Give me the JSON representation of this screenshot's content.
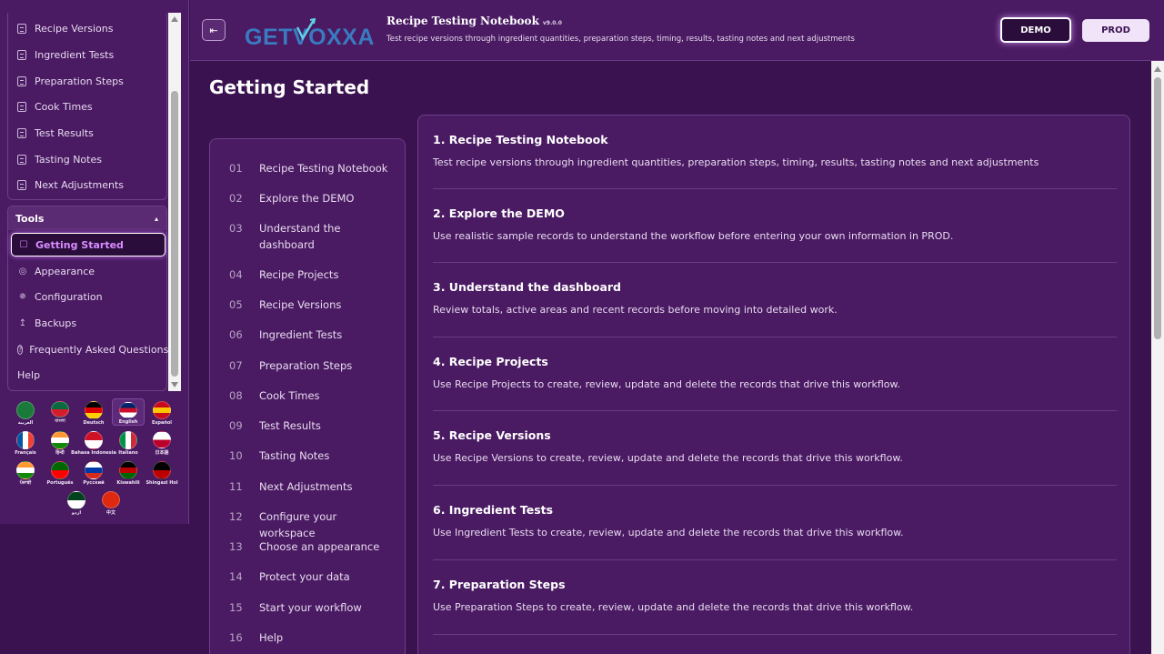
{
  "sidebar": {
    "nav_items": [
      {
        "label": "Recipe Versions"
      },
      {
        "label": "Ingredient Tests"
      },
      {
        "label": "Preparation Steps"
      },
      {
        "label": "Cook Times"
      },
      {
        "label": "Test Results"
      },
      {
        "label": "Tasting Notes"
      },
      {
        "label": "Next Adjustments"
      }
    ],
    "tools": {
      "title": "Tools",
      "collapse_glyph": "▴",
      "items": [
        {
          "label": "Getting Started",
          "icon": "☐",
          "icon_name": "cursor-icon"
        },
        {
          "label": "Appearance",
          "icon": "◎",
          "icon_name": "palette-icon"
        },
        {
          "label": "Configuration",
          "icon": "✵",
          "icon_name": "gear-icon"
        },
        {
          "label": "Backups",
          "icon": "↥",
          "icon_name": "upload-icon"
        },
        {
          "label": "Frequently Asked Questions",
          "icon": "?",
          "icon_name": "question-icon"
        },
        {
          "label": "Help",
          "icon": "",
          "icon_name": ""
        }
      ]
    },
    "languages": [
      {
        "label": "العربية",
        "colors": [
          "#1a7a3a",
          "#1a7a3a"
        ]
      },
      {
        "label": "বাংলা",
        "colors": [
          "#0a6a3e",
          "#d41c2c"
        ]
      },
      {
        "label": "Deutsch",
        "colors": [
          "#000000",
          "#dd0000",
          "#ffce00"
        ]
      },
      {
        "label": "English",
        "colors": [
          "#012169",
          "#c8102e",
          "#ffffff"
        ]
      },
      {
        "label": "Español",
        "colors": [
          "#c60b1e",
          "#ffc400",
          "#c60b1e"
        ]
      },
      {
        "label": "Français",
        "colors": [
          "#0055a4",
          "#ffffff",
          "#ef4135"
        ]
      },
      {
        "label": "हिन्दी",
        "colors": [
          "#ff9933",
          "#ffffff",
          "#138808"
        ]
      },
      {
        "label": "Bahasa Indonesia",
        "colors": [
          "#ce1126",
          "#ffffff"
        ]
      },
      {
        "label": "Italiano",
        "colors": [
          "#009246",
          "#ffffff",
          "#ce2b37"
        ]
      },
      {
        "label": "日本語",
        "colors": [
          "#ffffff",
          "#bc002d"
        ]
      },
      {
        "label": "ਪੰਜਾਬੀ",
        "colors": [
          "#ff9933",
          "#ffffff",
          "#138808"
        ]
      },
      {
        "label": "Português",
        "colors": [
          "#006600",
          "#ff0000"
        ]
      },
      {
        "label": "Русский",
        "colors": [
          "#ffffff",
          "#0039a6",
          "#d52b1e"
        ]
      },
      {
        "label": "Kiswahili",
        "colors": [
          "#000000",
          "#bb0000",
          "#006600"
        ]
      },
      {
        "label": "Shingazi Hol",
        "colors": [
          "#000000",
          "#bb0000"
        ]
      },
      {
        "label": "اردو",
        "colors": [
          "#01411c",
          "#ffffff"
        ]
      },
      {
        "label": "中文",
        "colors": [
          "#de2910",
          "#de2910"
        ]
      }
    ]
  },
  "header": {
    "toggle_glyph": "⇤",
    "logo": "GETVOXXA",
    "title": "Recipe Testing Notebook",
    "version": "v9.0.0",
    "subtitle": "Test recipe versions through ingredient quantities, preparation steps, timing, results, tasting notes and next adjustments",
    "demo_label": "DEMO",
    "prod_label": "PROD"
  },
  "main": {
    "page_title": "Getting Started",
    "toc": [
      {
        "num": "01",
        "label": "Recipe Testing Notebook"
      },
      {
        "num": "02",
        "label": "Explore the DEMO"
      },
      {
        "num": "03",
        "label": "Understand the dashboard"
      },
      {
        "num": "04",
        "label": "Recipe Projects"
      },
      {
        "num": "05",
        "label": "Recipe Versions"
      },
      {
        "num": "06",
        "label": "Ingredient Tests"
      },
      {
        "num": "07",
        "label": "Preparation Steps"
      },
      {
        "num": "08",
        "label": "Cook Times"
      },
      {
        "num": "09",
        "label": "Test Results"
      },
      {
        "num": "10",
        "label": "Tasting Notes"
      },
      {
        "num": "11",
        "label": "Next Adjustments"
      },
      {
        "num": "12",
        "label": "Configure your workspace"
      },
      {
        "num": "13",
        "label": "Choose an appearance"
      },
      {
        "num": "14",
        "label": "Protect your data"
      },
      {
        "num": "15",
        "label": "Start your workflow"
      },
      {
        "num": "16",
        "label": "Help"
      }
    ],
    "sections": [
      {
        "title": "1. Recipe Testing Notebook",
        "text": "Test recipe versions through ingredient quantities, preparation steps, timing, results, tasting notes and next adjustments"
      },
      {
        "title": "2. Explore the DEMO",
        "text": "Use realistic sample records to understand the workflow before entering your own information in PROD."
      },
      {
        "title": "3. Understand the dashboard",
        "text": "Review totals, active areas and recent records before moving into detailed work."
      },
      {
        "title": "4. Recipe Projects",
        "text": "Use Recipe Projects to create, review, update and delete the records that drive this workflow."
      },
      {
        "title": "5. Recipe Versions",
        "text": "Use Recipe Versions to create, review, update and delete the records that drive this workflow."
      },
      {
        "title": "6. Ingredient Tests",
        "text": "Use Ingredient Tests to create, review, update and delete the records that drive this workflow."
      },
      {
        "title": "7. Preparation Steps",
        "text": "Use Preparation Steps to create, review, update and delete the records that drive this workflow."
      }
    ]
  },
  "colors": {
    "background": "#3a1250",
    "panel": "#4a1a62",
    "accent": "#d98cff",
    "border": "#6e3f88"
  }
}
